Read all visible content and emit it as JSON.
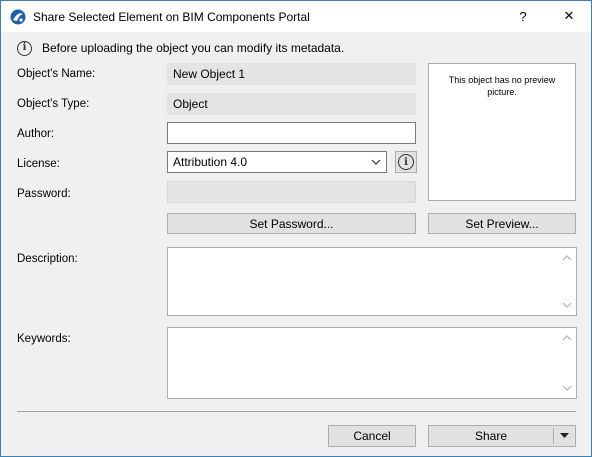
{
  "window": {
    "title": "Share Selected Element on BIM Components Portal",
    "help_label": "?",
    "close_label": "✕"
  },
  "info": {
    "text": "Before uploading the object you can modify its metadata."
  },
  "fields": {
    "name_label": "Object's Name:",
    "name_value": "New Object 1",
    "type_label": "Object's Type:",
    "type_value": "Object",
    "author_label": "Author:",
    "author_value": "",
    "license_label": "License:",
    "license_value": "Attribution 4.0",
    "password_label": "Password:",
    "password_value": "",
    "description_label": "Description:",
    "description_value": "",
    "keywords_label": "Keywords:",
    "keywords_value": ""
  },
  "preview": {
    "empty_text": "This object has no preview picture."
  },
  "buttons": {
    "set_password": "Set Password...",
    "set_preview": "Set Preview...",
    "cancel": "Cancel",
    "share": "Share"
  },
  "icons": {
    "app": "bim-portal-icon",
    "info": "info-icon",
    "license_info": "info-icon",
    "dropdown": "chevron-down-icon",
    "share_menu": "triangle-down-icon"
  },
  "colors": {
    "window_border": "#3c7fb1",
    "dialog_bg": "#f0f0f0",
    "button_bg": "#e1e1e1",
    "readonly_field_bg": "#e4e4e4"
  }
}
